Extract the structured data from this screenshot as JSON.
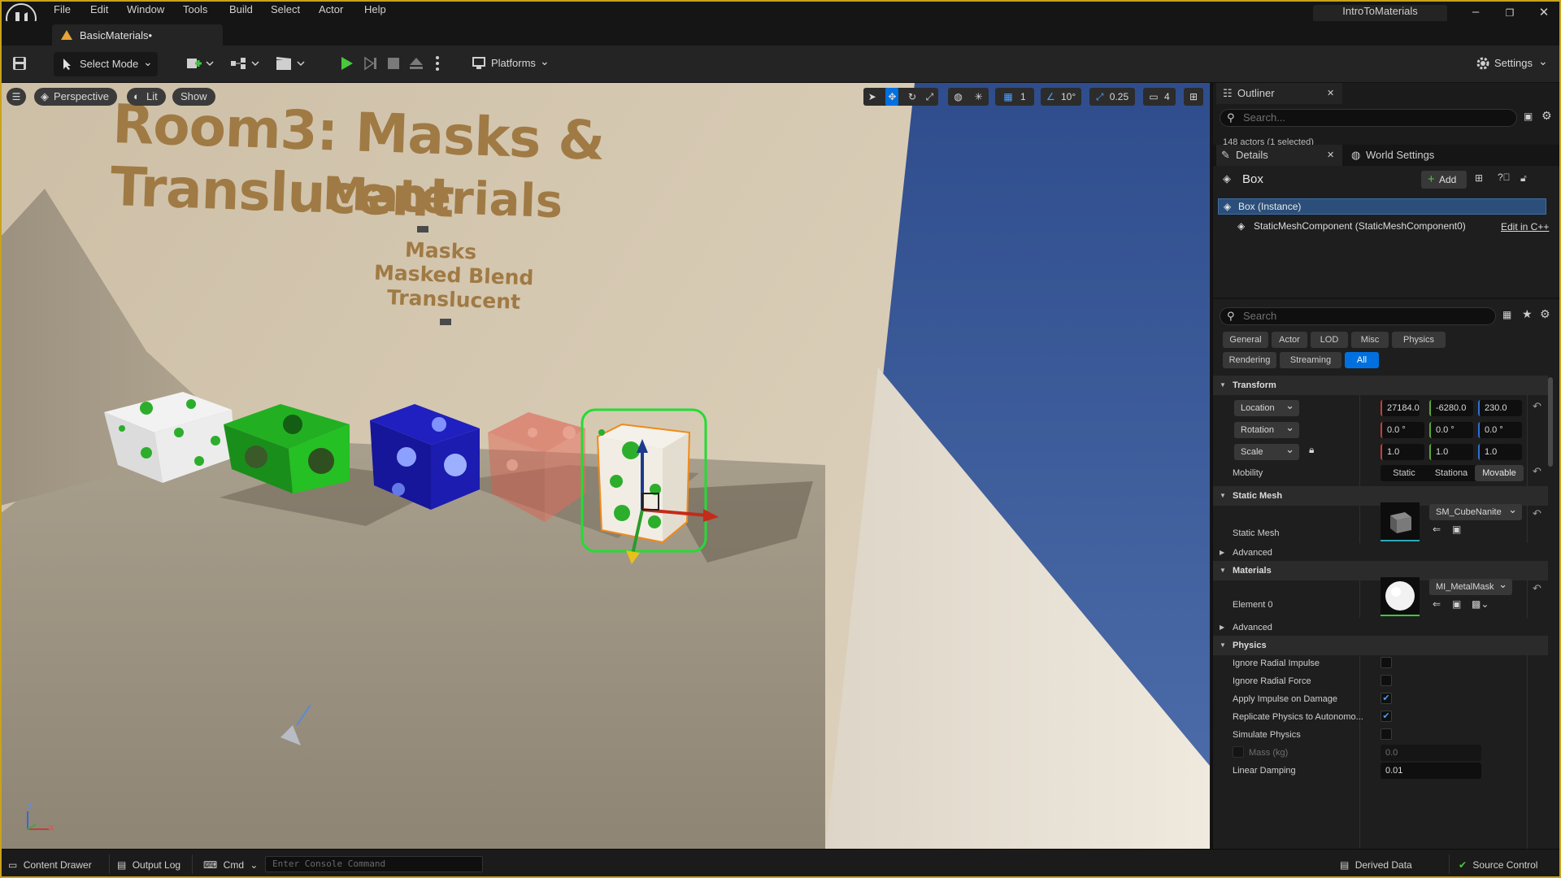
{
  "menu": {
    "items": [
      "File",
      "Edit",
      "Window",
      "Tools",
      "Build",
      "Select",
      "Actor",
      "Help"
    ],
    "project_title": "IntroToMaterials",
    "minimize": "–",
    "restore": "❐",
    "close": "✕"
  },
  "level_tab": {
    "label": "BasicMaterials•"
  },
  "toolbar": {
    "select_mode": "Select Mode",
    "platforms": "Platforms",
    "settings": "Settings"
  },
  "viewport": {
    "perspective": "Perspective",
    "lit": "Lit",
    "show": "Show",
    "grid_snap": "1",
    "angle_snap": "10°",
    "scale_snap": "0.25",
    "camera_speed": "4",
    "wall_text": {
      "line1": "Room3: Masks & Translucent",
      "line2": "Materials",
      "line3": "Masks",
      "line4": "Masked Blend",
      "line5": "Translucent"
    },
    "axis_z": "Z",
    "axis_x": "X"
  },
  "outliner": {
    "tab": "Outliner",
    "search_placeholder": "Search...",
    "actor_count": "148 actors (1 selected)"
  },
  "details": {
    "tab": "Details",
    "world_settings_tab": "World Settings",
    "actor_name": "Box",
    "add_button": "Add",
    "component_instance": "Box (Instance)",
    "component_mesh": "StaticMeshComponent (StaticMeshComponent0)",
    "edit_in_cpp": "Edit in C++",
    "search_placeholder": "Search",
    "filters": [
      "General",
      "Actor",
      "LOD",
      "Misc",
      "Physics",
      "Rendering",
      "Streaming",
      "All"
    ],
    "transform": {
      "header": "Transform",
      "location_label": "Location",
      "location": [
        "27184.0",
        "-6280.0",
        "230.0"
      ],
      "rotation_label": "Rotation",
      "rotation": [
        "0.0 °",
        "0.0 °",
        "0.0 °"
      ],
      "scale_label": "Scale",
      "scale": [
        "1.0",
        "1.0",
        "1.0"
      ],
      "mobility_label": "Mobility",
      "mobility_options": [
        "Static",
        "Stationa",
        "Movable"
      ],
      "mobility_selected": "Movable"
    },
    "static_mesh": {
      "header": "Static Mesh",
      "label": "Static Mesh",
      "value": "SM_CubeNanite",
      "advanced": "Advanced"
    },
    "materials": {
      "header": "Materials",
      "element_label": "Element 0",
      "value": "MI_MetalMask",
      "advanced": "Advanced"
    },
    "physics": {
      "header": "Physics",
      "rows": [
        {
          "label": "Ignore Radial Impulse",
          "checked": false
        },
        {
          "label": "Ignore Radial Force",
          "checked": false
        },
        {
          "label": "Apply Impulse on Damage",
          "checked": true
        },
        {
          "label": "Replicate Physics to Autonomo...",
          "checked": true
        },
        {
          "label": "Simulate Physics",
          "checked": false
        }
      ],
      "mass_label": "Mass (kg)",
      "mass_value": "0.0",
      "linear_damping_label": "Linear Damping",
      "linear_damping_value": "0.01"
    }
  },
  "statusbar": {
    "content_drawer": "Content Drawer",
    "output_log": "Output Log",
    "cmd": "Cmd",
    "console_placeholder": "Enter Console Command",
    "derived_data": "Derived Data",
    "source_control": "Source Control"
  },
  "colors": {
    "accent_blue": "#0070e0",
    "selection_green": "#22dd33",
    "frame_gold": "#c9a21a"
  }
}
